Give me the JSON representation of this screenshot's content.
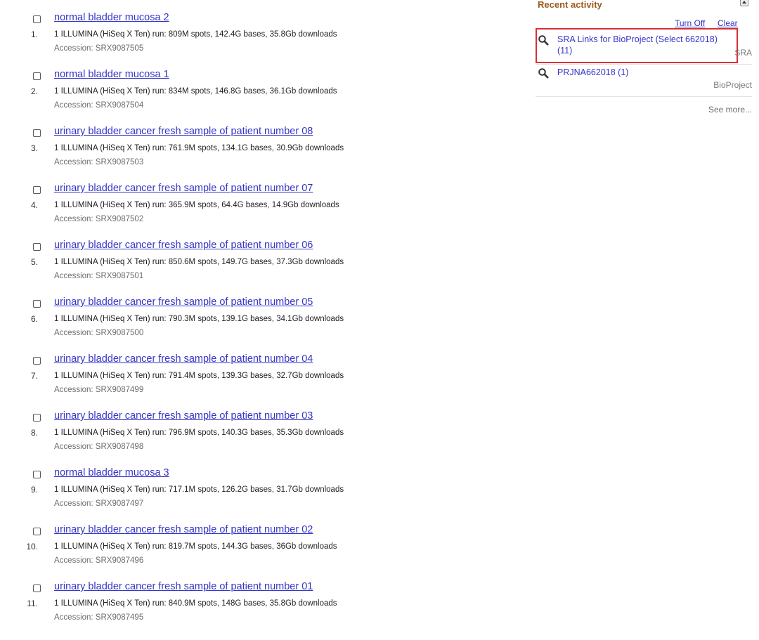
{
  "results": [
    {
      "num": "1.",
      "title": "normal bladder mucosa 2",
      "desc": "1 ILLUMINA (HiSeq X Ten) run: 809M spots, 142.4G bases, 35.8Gb downloads",
      "accession": "Accession: SRX9087505"
    },
    {
      "num": "2.",
      "title": "normal bladder mucosa 1",
      "desc": "1 ILLUMINA (HiSeq X Ten) run: 834M spots, 146.8G bases, 36.1Gb downloads",
      "accession": "Accession: SRX9087504"
    },
    {
      "num": "3.",
      "title": "urinary bladder cancer fresh sample of patient number 08",
      "desc": "1 ILLUMINA (HiSeq X Ten) run: 761.9M spots, 134.1G bases, 30.9Gb downloads",
      "accession": "Accession: SRX9087503"
    },
    {
      "num": "4.",
      "title": "urinary bladder cancer fresh sample of patient number 07",
      "desc": "1 ILLUMINA (HiSeq X Ten) run: 365.9M spots, 64.4G bases, 14.9Gb downloads",
      "accession": "Accession: SRX9087502"
    },
    {
      "num": "5.",
      "title": "urinary bladder cancer fresh sample of patient number 06",
      "desc": "1 ILLUMINA (HiSeq X Ten) run: 850.6M spots, 149.7G bases, 37.3Gb downloads",
      "accession": "Accession: SRX9087501"
    },
    {
      "num": "6.",
      "title": "urinary bladder cancer fresh sample of patient number 05",
      "desc": "1 ILLUMINA (HiSeq X Ten) run: 790.3M spots, 139.1G bases, 34.1Gb downloads",
      "accession": "Accession: SRX9087500"
    },
    {
      "num": "7.",
      "title": "urinary bladder cancer fresh sample of patient number 04",
      "desc": "1 ILLUMINA (HiSeq X Ten) run: 791.4M spots, 139.3G bases, 32.7Gb downloads",
      "accession": "Accession: SRX9087499"
    },
    {
      "num": "8.",
      "title": "urinary bladder cancer fresh sample of patient number 03",
      "desc": "1 ILLUMINA (HiSeq X Ten) run: 796.9M spots, 140.3G bases, 35.3Gb downloads",
      "accession": "Accession: SRX9087498"
    },
    {
      "num": "9.",
      "title": "normal bladder mucosa 3",
      "desc": "1 ILLUMINA (HiSeq X Ten) run: 717.1M spots, 126.2G bases, 31.7Gb downloads",
      "accession": "Accession: SRX9087497"
    },
    {
      "num": "10.",
      "title": "urinary bladder cancer fresh sample of patient number 02",
      "desc": "1 ILLUMINA (HiSeq X Ten) run: 819.7M spots, 144.3G bases, 36Gb downloads",
      "accession": "Accession: SRX9087496"
    },
    {
      "num": "11.",
      "title": "urinary bladder cancer fresh sample of patient number 01",
      "desc": "1 ILLUMINA (HiSeq X Ten) run: 840.9M spots, 148G bases, 35.8Gb downloads",
      "accession": "Accession: SRX9087495"
    }
  ],
  "recent_activity": {
    "title": "Recent activity",
    "turn_off": "Turn Off",
    "clear": "Clear",
    "items": [
      {
        "label_line1": "SRA Links for BioProject (Select 662018)",
        "label_line2": "(11)",
        "db": "SRA",
        "icon": "magnifier-icon"
      },
      {
        "label_line1": "PRJNA662018 (1)",
        "db": "BioProject",
        "icon": "magnifier-icon"
      }
    ],
    "see_more": "See more..."
  },
  "colors": {
    "link": "#3535c8",
    "heading": "#9b5a1a",
    "highlight": "#d83038",
    "muted": "#6d6d6d"
  }
}
